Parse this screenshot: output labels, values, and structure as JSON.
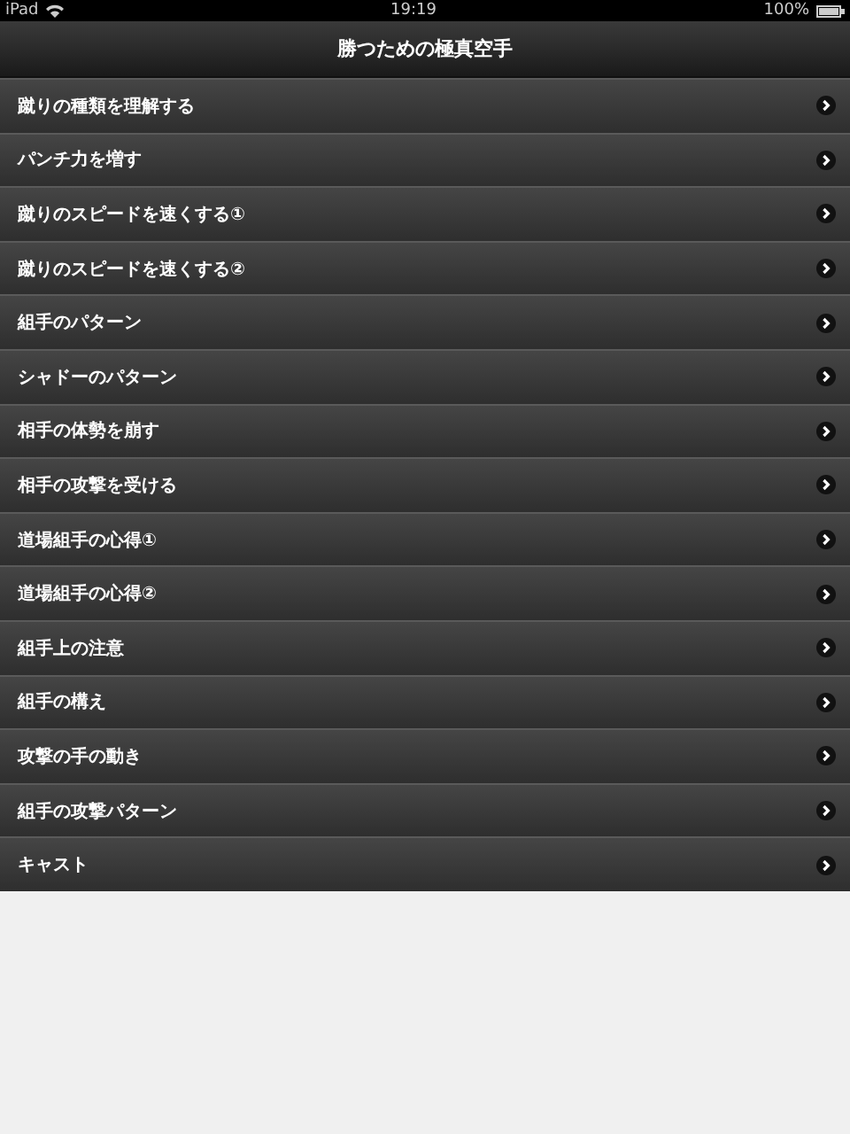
{
  "status_bar": {
    "device": "iPad",
    "time": "19:19",
    "battery": "100%"
  },
  "nav_bar": {
    "title": "勝つための極真空手"
  },
  "items": [
    {
      "label": "蹴りの種類を理解する"
    },
    {
      "label": "パンチ力を増す"
    },
    {
      "label": "蹴りのスピードを速くする①"
    },
    {
      "label": "蹴りのスピードを速くする②"
    },
    {
      "label": "組手のパターン"
    },
    {
      "label": "シャドーのパターン"
    },
    {
      "label": "相手の体勢を崩す"
    },
    {
      "label": "相手の攻撃を受ける"
    },
    {
      "label": "道場組手の心得①"
    },
    {
      "label": "道場組手の心得②"
    },
    {
      "label": "組手上の注意"
    },
    {
      "label": "組手の構え"
    },
    {
      "label": "攻撃の手の動き"
    },
    {
      "label": "組手の攻撃パターン"
    },
    {
      "label": "キャスト"
    }
  ]
}
